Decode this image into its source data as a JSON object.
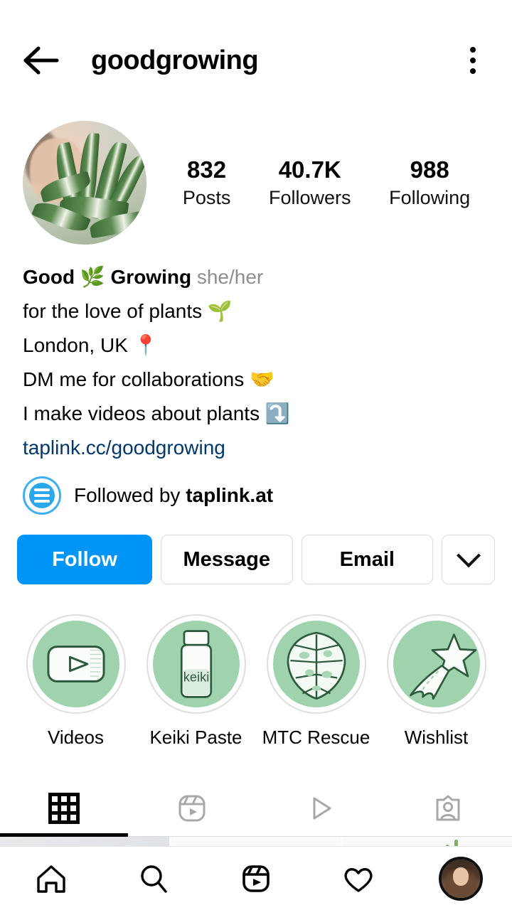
{
  "header": {
    "back_icon": "arrow-left-icon",
    "title": "goodgrowing",
    "menu_icon": "more-vertical-icon"
  },
  "profile": {
    "avatar_name": "profile-avatar",
    "stats": [
      {
        "num": "832",
        "label": "Posts"
      },
      {
        "num": "40.7K",
        "label": "Followers"
      },
      {
        "num": "988",
        "label": "Following"
      }
    ]
  },
  "bio": {
    "name_part1": "Good",
    "name_emoji": "🌿",
    "name_part2": "Growing",
    "pronouns": "she/her",
    "line2": "for the love of plants 🌱",
    "line3": "London, UK 📍",
    "line4": "DM me for collaborations 🤝",
    "line5": "I make videos about plants ⤵️",
    "link": "taplink.cc/goodgrowing"
  },
  "followed_by": {
    "prefix": "Followed by",
    "username": "taplink.at",
    "avatar_name": "taplink-avatar"
  },
  "actions": {
    "follow": "Follow",
    "message": "Message",
    "email": "Email",
    "more_icon": "chevron-down-icon"
  },
  "highlights": [
    {
      "label": "Videos",
      "icon": "video-player-icon"
    },
    {
      "label": "Keiki Paste",
      "icon": "bottle-icon",
      "bottle_text": "keiki"
    },
    {
      "label": "MTC Rescue",
      "icon": "monstera-leaf-icon"
    },
    {
      "label": "Wishlist",
      "icon": "shooting-star-icon"
    }
  ],
  "tabs": [
    {
      "name": "grid",
      "icon": "grid-icon",
      "active": true
    },
    {
      "name": "reels",
      "icon": "reels-icon",
      "active": false
    },
    {
      "name": "igtv",
      "icon": "play-icon",
      "active": false
    },
    {
      "name": "tagged",
      "icon": "tagged-person-icon",
      "active": false
    }
  ],
  "posts": [
    {
      "alt": "cat-by-window-post"
    },
    {
      "alt": "white-plant-post"
    },
    {
      "alt": "spiky-plant-post"
    }
  ],
  "bottom_nav": [
    {
      "name": "home",
      "icon": "home-icon"
    },
    {
      "name": "search",
      "icon": "search-icon"
    },
    {
      "name": "reels",
      "icon": "reels-icon"
    },
    {
      "name": "activity",
      "icon": "heart-icon"
    },
    {
      "name": "profile",
      "icon": "user-avatar"
    }
  ],
  "colors": {
    "primary": "#0095f6",
    "link": "#00376b",
    "muted": "#8e8e8e",
    "highlight_green": "#9ed3ae",
    "border": "#dbdbdb"
  }
}
